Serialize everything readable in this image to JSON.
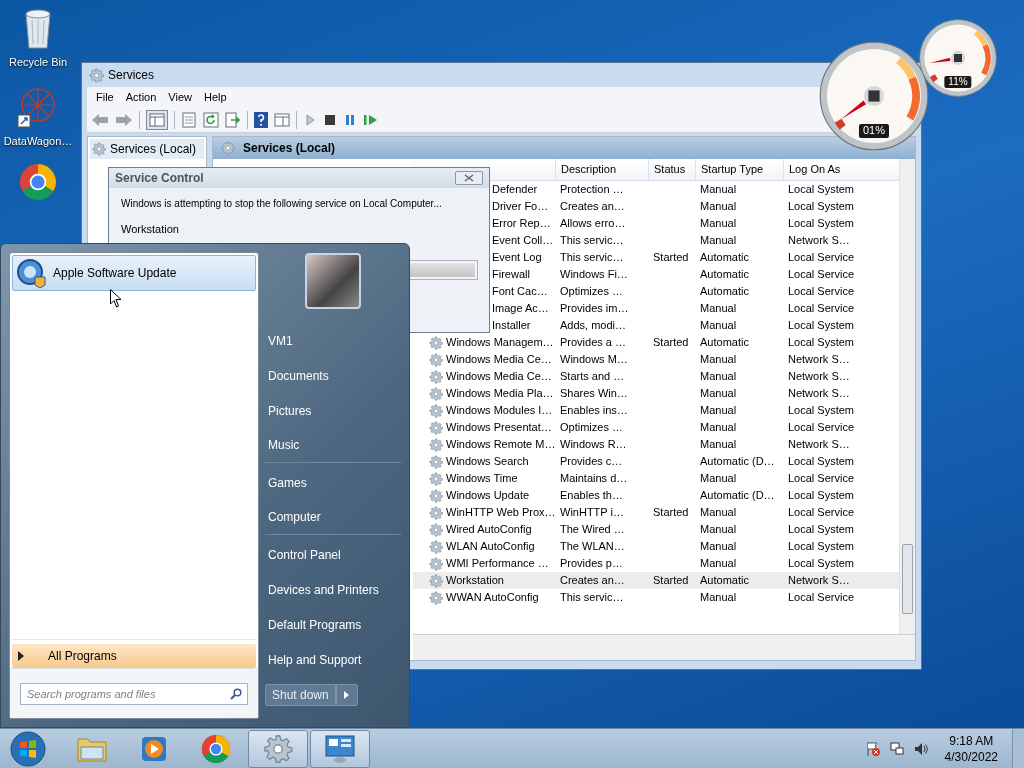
{
  "desktop_icons": [
    {
      "label": "Recycle Bin",
      "kind": "bin"
    },
    {
      "label": "DataWagon…",
      "kind": "shortcut"
    },
    {
      "kind": "chrome"
    }
  ],
  "services_window": {
    "title": "Services",
    "menu": [
      "File",
      "Action",
      "View",
      "Help"
    ],
    "tree": [
      {
        "label": "Services (Local)",
        "selected": true
      }
    ],
    "pane_title": "Services (Local)",
    "columns": [
      "Description",
      "Status",
      "Startup Type",
      "Log On As"
    ],
    "rows": [
      {
        "name": "Defender",
        "partly_hidden": true,
        "description": "Protection …",
        "startup_type": "Manual",
        "log_on_as": "Local System",
        "selected": false
      },
      {
        "name": "Driver Fo…",
        "partly_hidden": true,
        "description": "Creates an…",
        "startup_type": "Manual",
        "log_on_as": "Local System",
        "selected": false
      },
      {
        "name": "Error Rep…",
        "partly_hidden": true,
        "description": "Allows erro…",
        "startup_type": "Manual",
        "log_on_as": "Local System",
        "selected": false
      },
      {
        "name": "Event Coll…",
        "partly_hidden": true,
        "description": "This servic…",
        "startup_type": "Manual",
        "log_on_as": "Network S…",
        "selected": false
      },
      {
        "name": "Event Log",
        "partly_hidden": true,
        "description": "This servic…",
        "status": "Started",
        "startup_type": "Automatic",
        "log_on_as": "Local Service",
        "selected": false
      },
      {
        "name": "Firewall",
        "partly_hidden": true,
        "description": "Windows Fi…",
        "startup_type": "Automatic",
        "log_on_as": "Local Service",
        "selected": false
      },
      {
        "name": "Font Cac…",
        "partly_hidden": true,
        "description": "Optimizes …",
        "startup_type": "Automatic",
        "log_on_as": "Local Service",
        "selected": false
      },
      {
        "name": "Image Ac…",
        "partly_hidden": true,
        "description": "Provides im…",
        "startup_type": "Manual",
        "log_on_as": "Local Service",
        "selected": false
      },
      {
        "name": "Installer",
        "partly_hidden": true,
        "description": "Adds, modi…",
        "startup_type": "Manual",
        "log_on_as": "Local System",
        "selected": false
      },
      {
        "name": "Windows Managem…",
        "partly_hidden": false,
        "description": "Provides a …",
        "status": "Started",
        "startup_type": "Automatic",
        "log_on_as": "Local System",
        "selected": false
      },
      {
        "name": "Windows Media Ce…",
        "partly_hidden": false,
        "description": "Windows M…",
        "startup_type": "Manual",
        "log_on_as": "Network S…",
        "selected": false
      },
      {
        "name": "Windows Media Ce…",
        "partly_hidden": false,
        "description": "Starts and …",
        "startup_type": "Manual",
        "log_on_as": "Network S…",
        "selected": false
      },
      {
        "name": "Windows Media Pla…",
        "partly_hidden": false,
        "description": "Shares Win…",
        "startup_type": "Manual",
        "log_on_as": "Network S…",
        "selected": false
      },
      {
        "name": "Windows Modules I…",
        "partly_hidden": false,
        "description": "Enables ins…",
        "startup_type": "Manual",
        "log_on_as": "Local System",
        "selected": false
      },
      {
        "name": "Windows Presentat…",
        "partly_hidden": false,
        "description": "Optimizes …",
        "startup_type": "Manual",
        "log_on_as": "Local Service",
        "selected": false
      },
      {
        "name": "Windows Remote M…",
        "partly_hidden": false,
        "description": "Windows R…",
        "startup_type": "Manual",
        "log_on_as": "Network S…",
        "selected": false
      },
      {
        "name": "Windows Search",
        "partly_hidden": false,
        "description": "Provides c…",
        "startup_type": "Automatic (D…",
        "log_on_as": "Local System",
        "selected": false
      },
      {
        "name": "Windows Time",
        "partly_hidden": false,
        "description": "Maintains d…",
        "startup_type": "Manual",
        "log_on_as": "Local Service",
        "selected": false
      },
      {
        "name": "Windows Update",
        "partly_hidden": false,
        "description": "Enables th…",
        "startup_type": "Automatic (D…",
        "log_on_as": "Local System",
        "selected": false
      },
      {
        "name": "WinHTTP Web Prox…",
        "partly_hidden": false,
        "description": "WinHTTP i…",
        "status": "Started",
        "startup_type": "Manual",
        "log_on_as": "Local Service",
        "selected": false
      },
      {
        "name": "Wired AutoConfig",
        "partly_hidden": false,
        "description": "The Wired …",
        "startup_type": "Manual",
        "log_on_as": "Local System",
        "selected": false
      },
      {
        "name": "WLAN AutoConfig",
        "partly_hidden": false,
        "description": "The WLAN…",
        "startup_type": "Manual",
        "log_on_as": "Local System",
        "selected": false
      },
      {
        "name": "WMI Performance …",
        "partly_hidden": false,
        "description": "Provides p…",
        "startup_type": "Manual",
        "log_on_as": "Local System",
        "selected": false
      },
      {
        "name": "Workstation",
        "partly_hidden": false,
        "description": "Creates an…",
        "status": "Started",
        "startup_type": "Automatic",
        "log_on_as": "Network S…",
        "selected": true
      },
      {
        "name": "WWAN AutoConfig",
        "partly_hidden": false,
        "description": "This servic…",
        "startup_type": "Manual",
        "log_on_as": "Local Service",
        "selected": false
      }
    ]
  },
  "service_control": {
    "title": "Service Control",
    "message": "Windows is attempting to stop the following service on Local Computer...",
    "service": "Workstation"
  },
  "start_menu": {
    "programs": [
      {
        "label": "Apple Software Update",
        "selected": true
      }
    ],
    "all_programs": "All Programs",
    "search": {
      "placeholder": "Search programs and files"
    },
    "places": [
      {
        "label": "VM1",
        "separator_after": false
      },
      {
        "label": "Documents",
        "separator_after": false
      },
      {
        "label": "Pictures",
        "separator_after": false
      },
      {
        "label": "Music",
        "separator_after": true
      },
      {
        "label": "Games",
        "separator_after": false
      },
      {
        "label": "Computer",
        "separator_after": true
      },
      {
        "label": "Control Panel",
        "separator_after": false
      },
      {
        "label": "Devices and Printers",
        "separator_after": false
      },
      {
        "label": "Default Programs",
        "separator_after": false
      },
      {
        "label": "Help and Support",
        "separator_after": false
      }
    ],
    "shutdown": "Shut down"
  },
  "gadgets": [
    {
      "reading": "01%"
    },
    {
      "reading": "11%"
    }
  ],
  "progress": {
    "level": 1
  },
  "taskbar": {
    "buttons": [
      {
        "kind": "explorer",
        "active": false
      },
      {
        "kind": "media",
        "active": false
      },
      {
        "kind": "chrome",
        "active": false
      },
      {
        "kind": "services",
        "active": true
      },
      {
        "kind": "monitor",
        "active": true
      }
    ],
    "time": "9:18 AM",
    "date": "4/30/2022"
  }
}
